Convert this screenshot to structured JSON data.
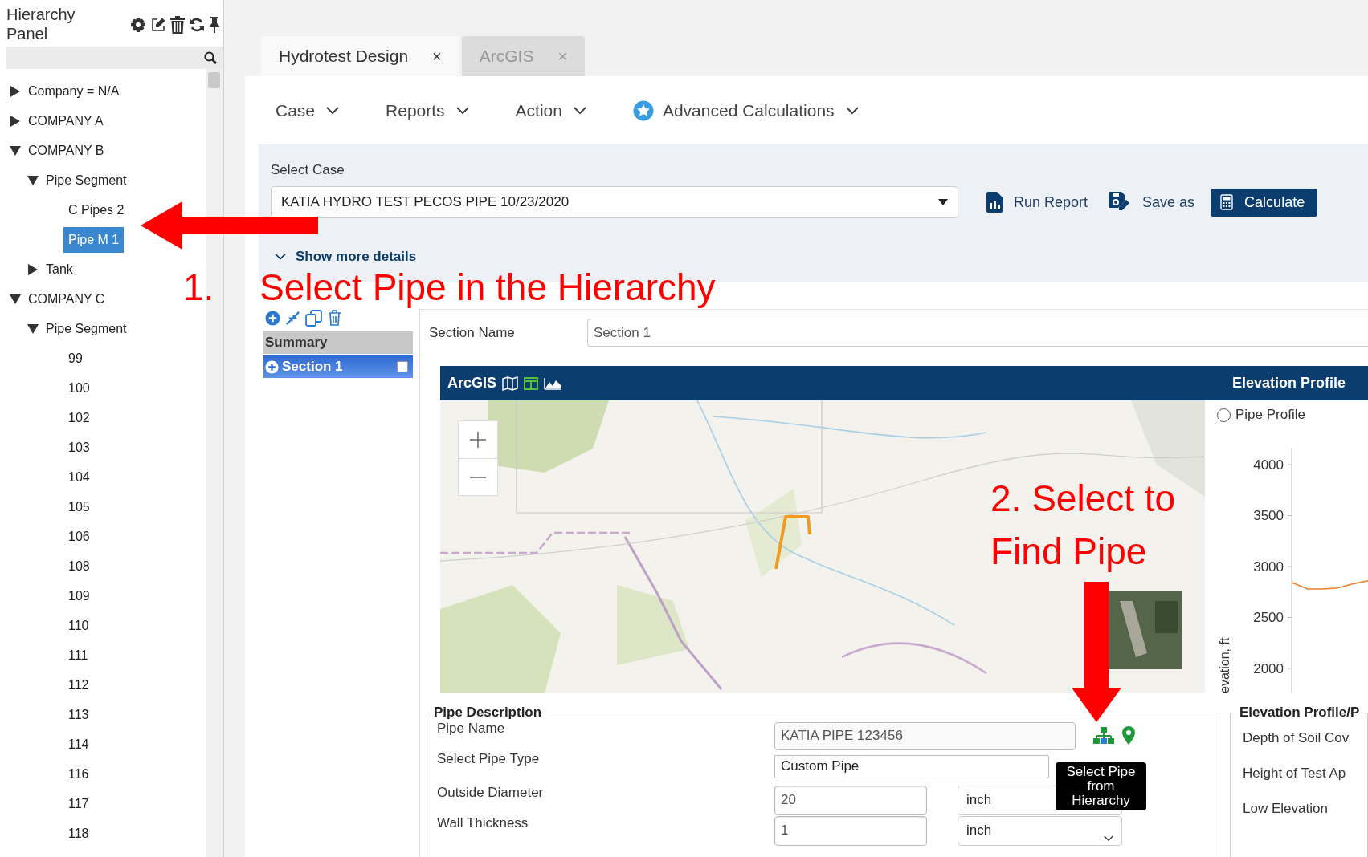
{
  "panel": {
    "title": "Hierarchy Panel",
    "tree": [
      {
        "label": "Company = N/A",
        "expanded": false,
        "selected": false
      },
      {
        "label": "COMPANY A",
        "expanded": false,
        "selected": false
      },
      {
        "label": "COMPANY B",
        "expanded": true,
        "selected": false,
        "children": [
          {
            "label": "Pipe Segment",
            "expanded": true,
            "selected": false,
            "children": [
              {
                "label": "C Pipes 2",
                "selected": false
              },
              {
                "label": "Pipe M 1",
                "selected": true
              }
            ]
          },
          {
            "label": "Tank",
            "expanded": false,
            "selected": false
          }
        ]
      },
      {
        "label": "COMPANY C",
        "expanded": true,
        "selected": false,
        "children": [
          {
            "label": "Pipe Segment",
            "expanded": true,
            "selected": false,
            "children": [
              {
                "label": "99",
                "selected": false
              },
              {
                "label": "100",
                "selected": false
              },
              {
                "label": "102",
                "selected": false
              },
              {
                "label": "103",
                "selected": false
              },
              {
                "label": "104",
                "selected": false
              },
              {
                "label": "105",
                "selected": false
              },
              {
                "label": "106",
                "selected": false
              },
              {
                "label": "108",
                "selected": false
              },
              {
                "label": "109",
                "selected": false
              },
              {
                "label": "110",
                "selected": false
              },
              {
                "label": "111",
                "selected": false
              },
              {
                "label": "112",
                "selected": false
              },
              {
                "label": "113",
                "selected": false
              },
              {
                "label": "114",
                "selected": false
              },
              {
                "label": "116",
                "selected": false
              },
              {
                "label": "117",
                "selected": false
              },
              {
                "label": "118",
                "selected": false
              }
            ]
          }
        ]
      }
    ]
  },
  "tabs": [
    {
      "label": "Hydrotest Design",
      "close": "×",
      "selected": true
    },
    {
      "label": "ArcGIS",
      "close": "×",
      "selected": false
    }
  ],
  "menu": [
    {
      "label": "Case",
      "kind": "plain"
    },
    {
      "label": "Reports",
      "kind": "plain"
    },
    {
      "label": "Action",
      "kind": "plain"
    },
    {
      "label": "Advanced Calculations",
      "kind": "featured"
    }
  ],
  "case": {
    "label": "Select Case",
    "value": "KATIA HYDRO TEST PECOS PIPE 10/23/2020",
    "actions": [
      {
        "label": "Run Report",
        "kind": "report"
      },
      {
        "label": "Save as",
        "kind": "save"
      },
      {
        "label": "Calculate",
        "kind": "primary"
      }
    ],
    "details_link": "Show more details"
  },
  "sections": {
    "header": "Summary",
    "items": [
      {
        "label": "Section 1",
        "selected": true,
        "checked": false
      }
    ]
  },
  "section_name": {
    "label": "Section Name",
    "value": "Section 1"
  },
  "map_card": {
    "title": "ArcGIS",
    "profile_title": "Elevation Profile",
    "profile_option": {
      "label": "Pipe Profile",
      "selected": false
    },
    "chart_data": {
      "type": "line",
      "ylabel": "evation, ft",
      "categories": [
        null,
        null,
        null,
        null,
        null,
        null
      ],
      "yticks": [
        2000,
        2500,
        3000,
        3500,
        4000
      ],
      "ylim": [
        1756,
        4630
      ],
      "series": [
        {
          "color": "#e8802a",
          "values": [
            2840,
            2780,
            2780,
            2790,
            2830,
            2860
          ]
        }
      ]
    }
  },
  "pipe_description": {
    "legend": "Pipe Description",
    "fields": [
      {
        "label": "Pipe Name",
        "value": "KATIA PIPE 123456",
        "kind": "readonly"
      },
      {
        "label": "Select Pipe Type",
        "value": "Custom Pipe",
        "kind": "select"
      },
      {
        "label": "Outside Diameter",
        "value": "20",
        "unit": "inch",
        "kind": "input"
      },
      {
        "label": "Wall Thickness",
        "value": "1",
        "unit": "inch",
        "kind": "input"
      }
    ],
    "tooltip": "Select Pipe from Hierarchy"
  },
  "elevation_settings": {
    "legend": "Elevation Profile/P",
    "fields": [
      "Depth of Soil Cov",
      "Height of Test Ap",
      "Low Elevation"
    ]
  },
  "annotations": [
    {
      "number": "1.",
      "text": "Select Pipe in the Hierarchy"
    },
    {
      "text": "2. Select to Find Pipe"
    }
  ]
}
